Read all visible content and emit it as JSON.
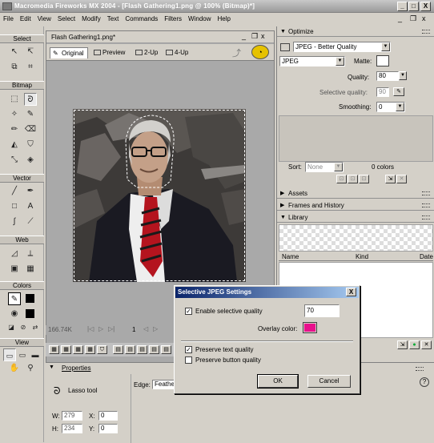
{
  "window": {
    "title": "Macromedia Fireworks MX 2004 - [Flash Gathering1.png @ 100% (Bitmap)*]",
    "minimize": "_",
    "maximize": "□",
    "close": "X"
  },
  "menubar": {
    "items": [
      "File",
      "Edit",
      "View",
      "Select",
      "Modify",
      "Text",
      "Commands",
      "Filters",
      "Window",
      "Help"
    ],
    "mdi_minimize": "_",
    "mdi_restore": "❐",
    "mdi_close": "x"
  },
  "tools": {
    "sections": [
      "Select",
      "Bitmap",
      "Vector",
      "Web",
      "Colors",
      "View"
    ]
  },
  "document": {
    "title": "Flash Gathering1.png*",
    "tabs": [
      "Original",
      "Preview",
      "2-Up",
      "4-Up"
    ],
    "size_label": "166.74K",
    "frame": "1"
  },
  "properties": {
    "header": "Properties",
    "tool_name": "Lasso tool",
    "edge_label": "Edge:",
    "edge_value": "Feathe",
    "w_label": "W:",
    "w_value": "279",
    "h_label": "H:",
    "h_value": "234",
    "x_label": "X:",
    "x_value": "0",
    "y_label": "Y:",
    "y_value": "0",
    "help": "?"
  },
  "optimize": {
    "header": "Optimize",
    "preset": "JPEG - Better Quality",
    "format": "JPEG",
    "matte_label": "Matte:",
    "quality_label": "Quality:",
    "quality_value": "80",
    "selective_label": "Selective quality:",
    "selective_value": "90",
    "smoothing_label": "Smoothing:",
    "smoothing_value": "0",
    "sort_label": "Sort:",
    "sort_value": "None",
    "colors_count": "0 colors"
  },
  "panels": {
    "assets": "Assets",
    "frames": "Frames and History",
    "library": "Library",
    "library_columns": [
      "Name",
      "Kind",
      "Date"
    ]
  },
  "dialog": {
    "title": "Selective JPEG Settings",
    "close": "X",
    "enable_label": "Enable selective quality",
    "enable_checked": true,
    "quality_value": "70",
    "overlay_label": "Overlay color:",
    "overlay_color": "#e8108c",
    "preserve_text_label": "Preserve text quality",
    "preserve_text_checked": true,
    "preserve_button_label": "Preserve button quality",
    "preserve_button_checked": false,
    "ok_label": "OK",
    "cancel_label": "Cancel"
  }
}
